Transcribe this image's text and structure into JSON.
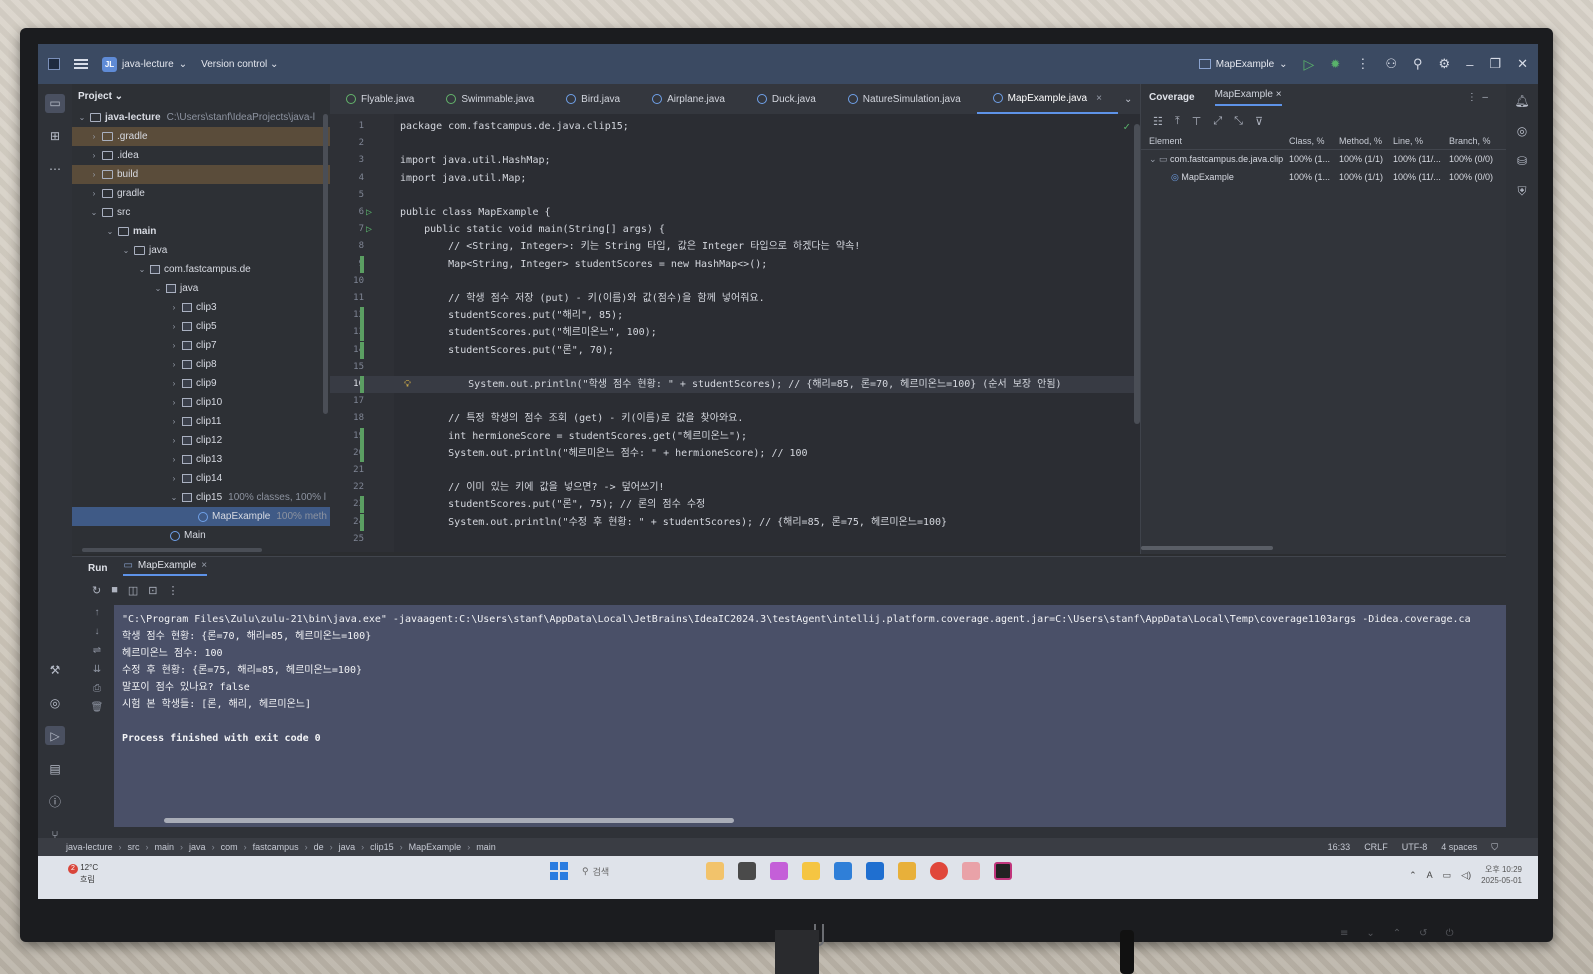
{
  "window": {
    "project_name": "java-lecture",
    "project_badge": "JL",
    "version_control": "Version control",
    "run_config": "MapExample"
  },
  "project_panel": {
    "title": "Project",
    "root_label": "java-lecture",
    "root_path": "C:\\Users\\stanf\\IdeaProjects\\java-l",
    "items": [
      {
        "label": ".gradle"
      },
      {
        "label": ".idea"
      },
      {
        "label": "build"
      },
      {
        "label": "gradle"
      },
      {
        "label": "src"
      },
      {
        "label": "main"
      },
      {
        "label": "java"
      },
      {
        "label": "com.fastcampus.de"
      },
      {
        "label": "java"
      },
      {
        "label": "clip3"
      },
      {
        "label": "clip5"
      },
      {
        "label": "clip7"
      },
      {
        "label": "clip8"
      },
      {
        "label": "clip9"
      },
      {
        "label": "clip10"
      },
      {
        "label": "clip11"
      },
      {
        "label": "clip12"
      },
      {
        "label": "clip13"
      },
      {
        "label": "clip14"
      },
      {
        "label": "clip15",
        "note": "100% classes, 100% l"
      },
      {
        "label": "MapExample",
        "note": "100% meth"
      },
      {
        "label": "Main"
      }
    ]
  },
  "tabs": [
    {
      "label": "Flyable.java"
    },
    {
      "label": "Swimmable.java"
    },
    {
      "label": "Bird.java"
    },
    {
      "label": "Airplane.java"
    },
    {
      "label": "Duck.java"
    },
    {
      "label": "NatureSimulation.java"
    },
    {
      "label": "MapExample.java"
    }
  ],
  "editor": {
    "lines": [
      {
        "n": "1",
        "text": "package com.fastcampus.de.java.clip15;"
      },
      {
        "n": "2",
        "text": ""
      },
      {
        "n": "3",
        "text": "import java.util.HashMap;"
      },
      {
        "n": "4",
        "text": "import java.util.Map;"
      },
      {
        "n": "5",
        "text": ""
      },
      {
        "n": "6",
        "text": "public class MapExample {"
      },
      {
        "n": "7",
        "text": "    public static void main(String[] args) {"
      },
      {
        "n": "8",
        "text": "        // <String, Integer>: 키는 String 타입, 값은 Integer 타입으로 하겠다는 약속!"
      },
      {
        "n": "9",
        "text": "        Map<String, Integer> studentScores = new HashMap<>();"
      },
      {
        "n": "10",
        "text": ""
      },
      {
        "n": "11",
        "text": "        // 학생 점수 저장 (put) - 키(이름)와 값(점수)을 함께 넣어줘요."
      },
      {
        "n": "12",
        "text": "        studentScores.put(\"해리\", 85);"
      },
      {
        "n": "13",
        "text": "        studentScores.put(\"헤르미온느\", 100);"
      },
      {
        "n": "14",
        "text": "        studentScores.put(\"론\", 70);"
      },
      {
        "n": "15",
        "text": ""
      },
      {
        "n": "16",
        "text": "        System.out.println(\"학생 점수 현황: \" + studentScores); // {해리=85, 론=70, 헤르미온느=100} (순서 보장 안됨)"
      },
      {
        "n": "17",
        "text": ""
      },
      {
        "n": "18",
        "text": "        // 특정 학생의 점수 조회 (get) - 키(이름)로 값을 찾아와요."
      },
      {
        "n": "19",
        "text": "        int hermioneScore = studentScores.get(\"헤르미온느\");"
      },
      {
        "n": "20",
        "text": "        System.out.println(\"헤르미온느 점수: \" + hermioneScore); // 100"
      },
      {
        "n": "21",
        "text": ""
      },
      {
        "n": "22",
        "text": "        // 이미 있는 키에 값을 넣으면? -> 덮어쓰기!"
      },
      {
        "n": "23",
        "text": "        studentScores.put(\"론\", 75); // 론의 점수 수정"
      },
      {
        "n": "24",
        "text": "        System.out.println(\"수정 후 현황: \" + studentScores); // {해리=85, 론=75, 헤르미온느=100}"
      },
      {
        "n": "25",
        "text": ""
      }
    ]
  },
  "coverage": {
    "tab_title": "Coverage",
    "tab_file": "MapExample",
    "headers": {
      "element": "Element",
      "class": "Class, %",
      "method": "Method, %",
      "line": "Line, %",
      "branch": "Branch, %"
    },
    "rows": [
      {
        "element": "com.fastcampus.de.java.clip",
        "class": "100% (1...",
        "method": "100% (1/1)",
        "line": "100% (11/...",
        "branch": "100% (0/0)"
      },
      {
        "element": "MapExample",
        "class": "100% (1...",
        "method": "100% (1/1)",
        "line": "100% (11/...",
        "branch": "100% (0/0)"
      }
    ]
  },
  "run": {
    "title": "Run",
    "tab": "MapExample",
    "output": [
      "\"C:\\Program Files\\Zulu\\zulu-21\\bin\\java.exe\" -javaagent:C:\\Users\\stanf\\AppData\\Local\\JetBrains\\IdeaIC2024.3\\testAgent\\intellij.platform.coverage.agent.jar=C:\\Users\\stanf\\AppData\\Local\\Temp\\coverage1103args -Didea.coverage.ca",
      "학생 점수 현황: {론=70, 해리=85, 헤르미온느=100}",
      "헤르미온느 점수: 100",
      "수정 후 현황: {론=75, 해리=85, 헤르미온느=100}",
      "말포이 점수 있나요? false",
      "시험 본 학생들: [론, 해리, 헤르미온느]",
      "",
      "Process finished with exit code 0"
    ]
  },
  "statusbar": {
    "breadcrumb": [
      "java-lecture",
      "src",
      "main",
      "java",
      "com",
      "fastcampus",
      "de",
      "java",
      "clip15",
      "MapExample",
      "main"
    ],
    "position": "16:33",
    "line_sep": "CRLF",
    "encoding": "UTF-8",
    "indent": "4 spaces"
  },
  "taskbar": {
    "weather_temp": "12°C",
    "weather_desc": "흐림",
    "weather_badge": "2",
    "search": "검색",
    "time": "오후 10:29",
    "date": "2025-05-01"
  }
}
